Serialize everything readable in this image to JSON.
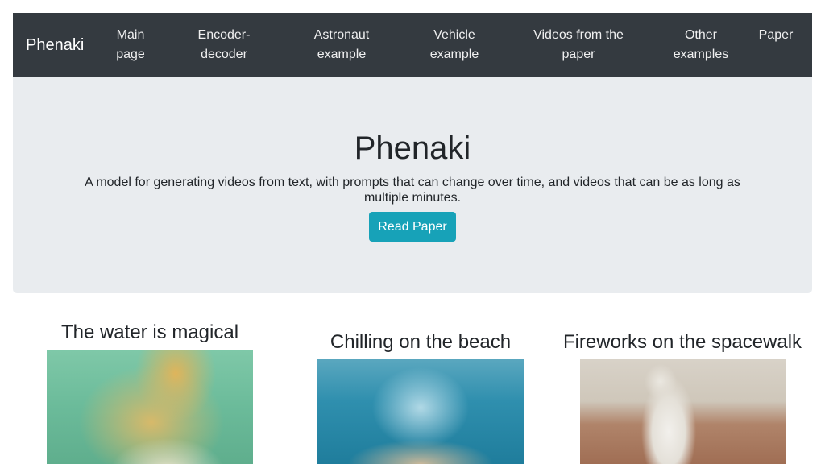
{
  "navbar": {
    "brand": "Phenaki",
    "links": [
      {
        "label": "Main page"
      },
      {
        "label": "Encoder-decoder"
      },
      {
        "label": "Astronaut example"
      },
      {
        "label": "Vehicle example"
      },
      {
        "label": "Videos from the paper"
      },
      {
        "label": "Other examples"
      },
      {
        "label": "Paper"
      }
    ]
  },
  "hero": {
    "title": "Phenaki",
    "description": "A model for generating videos from text, with prompts that can change over time, and videos that can be as long as multiple minutes.",
    "button_label": "Read Paper"
  },
  "examples": [
    {
      "title": "The water is magical"
    },
    {
      "title": "Chilling on the beach"
    },
    {
      "title": "Fireworks on the spacewalk"
    }
  ],
  "colors": {
    "navbar_bg": "#343a40",
    "hero_bg": "#e9ecef",
    "button_bg": "#17a2b8",
    "text": "#212529"
  }
}
